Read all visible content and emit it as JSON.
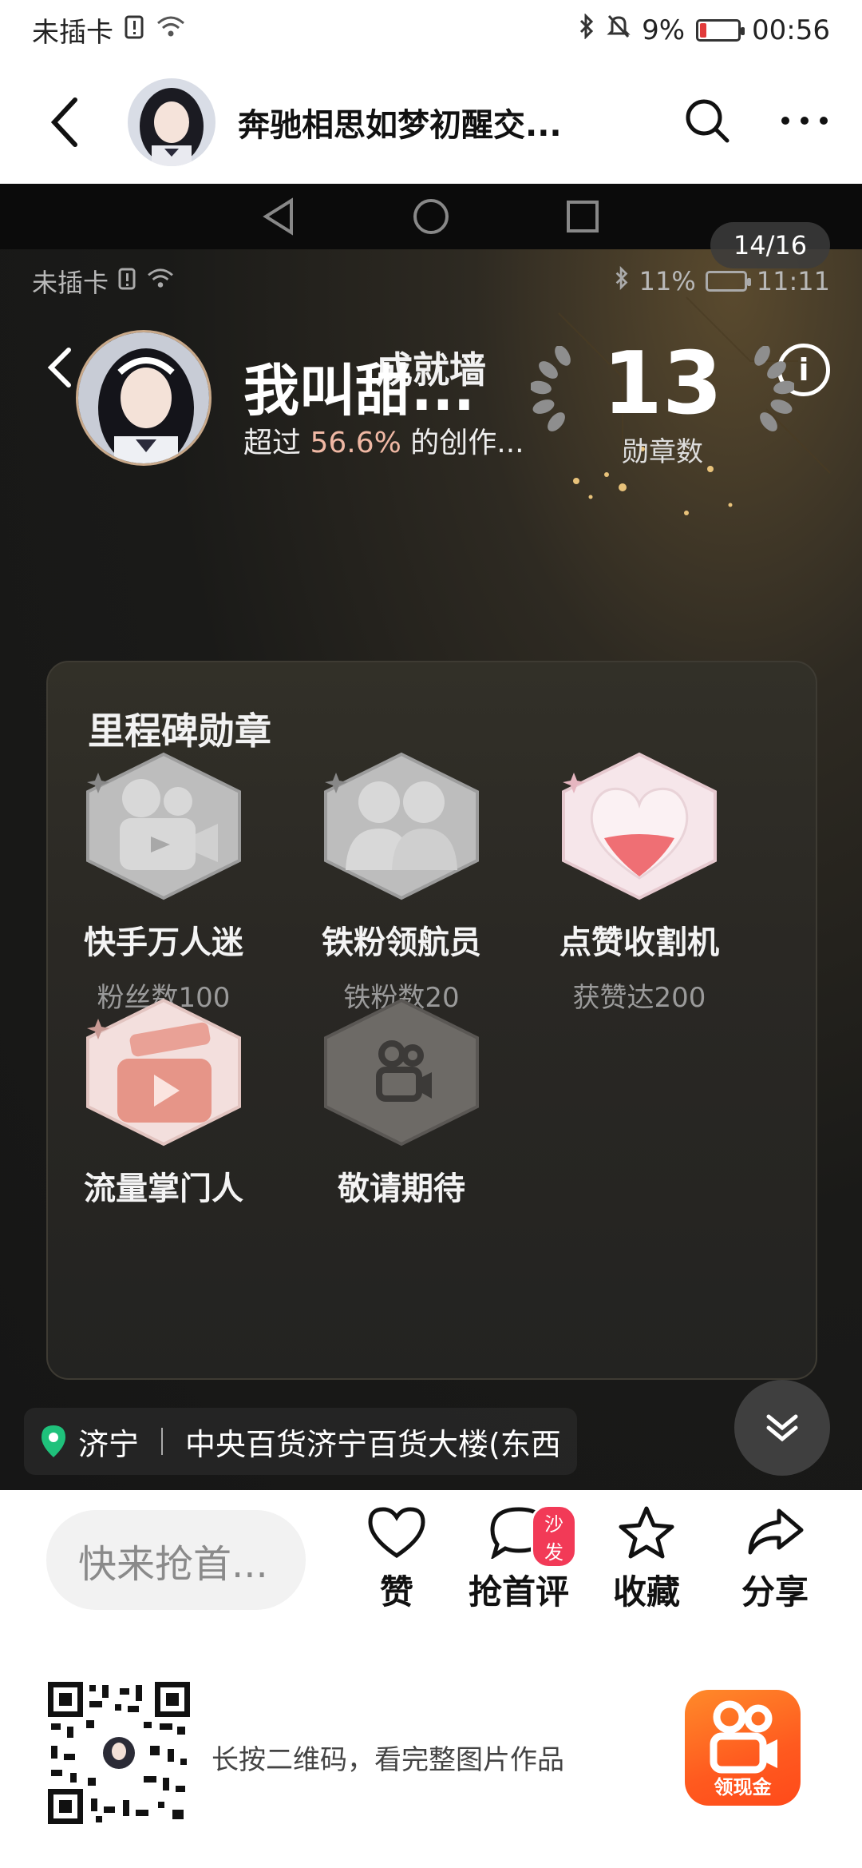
{
  "status_outer": {
    "carrier": "未插卡",
    "battery": "9%",
    "time": "00:56"
  },
  "header": {
    "title": "奔驰相思如梦初醒交..."
  },
  "viewer": {
    "page_indicator": "14/16"
  },
  "status_inner": {
    "carrier": "未插卡",
    "battery": "11%",
    "time": "11:11"
  },
  "achievement": {
    "title": "成就墙",
    "profile": {
      "name": "我叫甜...",
      "sub_prefix": "超过",
      "sub_percent": "56.6%",
      "sub_suffix": "的创作..."
    },
    "badge_count": "13",
    "badge_count_label": "勋章数",
    "milestone_title": "里程碑勋章",
    "medals": [
      {
        "name": "快手万人迷",
        "desc": "粉丝数100",
        "icon": "camera-icon",
        "unlocked": false
      },
      {
        "name": "铁粉领航员",
        "desc": "铁粉数20",
        "icon": "fans-icon",
        "unlocked": false
      },
      {
        "name": "点赞收割机",
        "desc": "获赞达200",
        "icon": "heart-icon",
        "unlocked": true
      },
      {
        "name": "流量掌门人",
        "desc": "",
        "icon": "play-icon",
        "unlocked": true
      },
      {
        "name": "敬请期待",
        "desc": "",
        "icon": "kuaishou-icon",
        "unlocked": false
      }
    ]
  },
  "location": {
    "city": "济宁",
    "place": "中央百货济宁百货大楼(东西"
  },
  "actions": {
    "comment_placeholder": "快来抢首...",
    "like": "赞",
    "first_comment": "抢首评",
    "sofa_badge": "沙发",
    "favorite": "收藏",
    "share": "分享"
  },
  "footer": {
    "hint": "长按二维码，看完整图片作品",
    "app_label": "领现金"
  },
  "colors": {
    "accent_pink": "#f0b8a4",
    "brand_orange": "#ff5a1f",
    "sofa_red": "#f23a57"
  }
}
